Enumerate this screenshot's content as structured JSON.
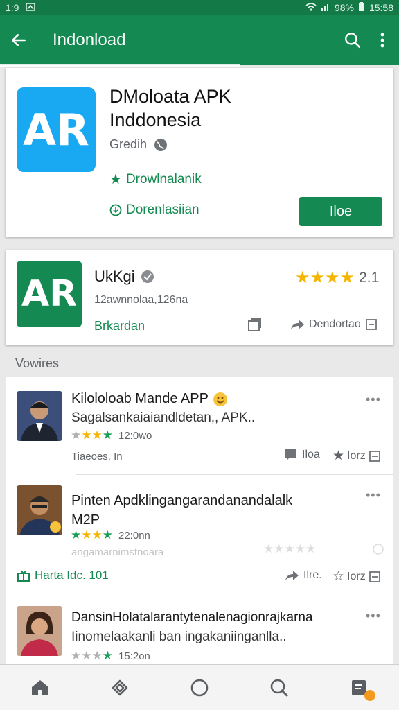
{
  "status": {
    "time": "1:9",
    "battery": "98%",
    "clock": "15:58"
  },
  "toolbar": {
    "title": "Indonload"
  },
  "featured": {
    "icon_text": "AR",
    "title_line1": "DMoloata APK",
    "title_line2": "Inddonesia",
    "developer": "Gredih",
    "rating_label": "Drowlnalanik",
    "download_label": "Dorenlasiian",
    "install_label": "Iloe",
    "icon_color": "#18a9f2"
  },
  "second": {
    "icon_text": "AR",
    "name": "UkKgi",
    "meta": "12awnnolaa,126na",
    "category": "Brkardan",
    "rating_value": "2.1",
    "action_label": "Dendortao"
  },
  "section_title": "Vowires",
  "reviews": [
    {
      "title": "Kilololoab Mande APP",
      "body": "Sagalsankaiaiandldetan,, APK..",
      "stars_text": "12:0wo",
      "footer": "Tiaeoes. In",
      "action1": "Iloa",
      "action2": "Iorz"
    },
    {
      "title": "Pinten Apdklingangarandanandalalk",
      "title2": "M2P",
      "stars_text": "22:0nn",
      "sub": "angamarnimstnoara",
      "footer": "Harta Idc. 101",
      "action1": "Ilre.",
      "action2": "Iorz"
    },
    {
      "title": "DansinHolatalarantytenalenagionrajkarna",
      "body": "Iinomelaakanli ban ingakaniinganlla..",
      "stars_text": "15:2on"
    }
  ]
}
